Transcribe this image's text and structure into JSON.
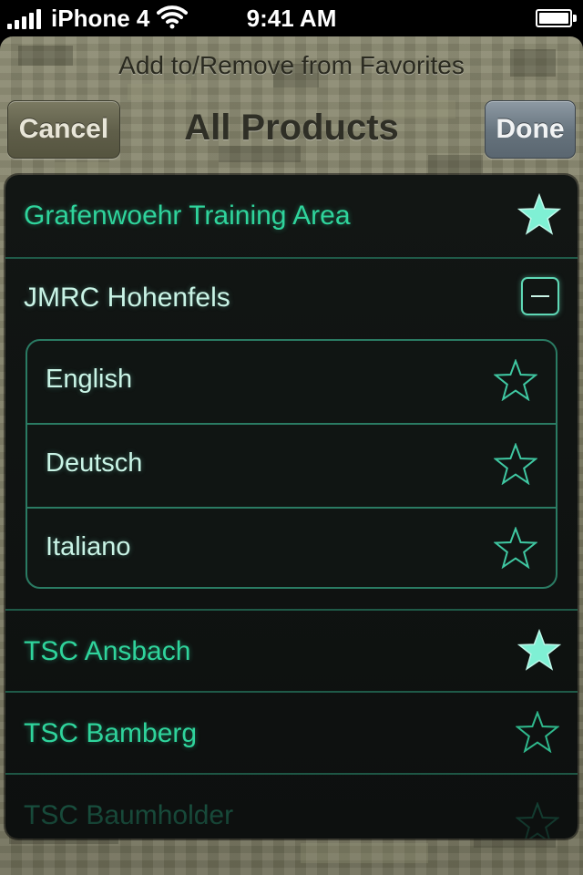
{
  "status_bar": {
    "carrier": "iPhone 4",
    "time": "9:41 AM",
    "signal_bars": 5,
    "battery_level": 1.0
  },
  "header": {
    "prompt": "Add to/Remove from Favorites",
    "title": "All Products",
    "cancel_label": "Cancel",
    "done_label": "Done"
  },
  "colors": {
    "accent_green": "#2fd49c",
    "divider": "#1f5a48",
    "star_filled": "#7ff0d4"
  },
  "list": {
    "items": [
      {
        "label": "Grafenwoehr Training Area",
        "favorite": true
      },
      {
        "label": "JMRC Hohenfels",
        "expanded": true,
        "languages": [
          {
            "label": "English",
            "favorite": false
          },
          {
            "label": "Deutsch",
            "favorite": false
          },
          {
            "label": "Italiano",
            "favorite": false
          }
        ]
      },
      {
        "label": "TSC Ansbach",
        "favorite": true
      },
      {
        "label": "TSC Bamberg",
        "favorite": false
      },
      {
        "label": "TSC Baumholder",
        "favorite": false
      }
    ]
  }
}
